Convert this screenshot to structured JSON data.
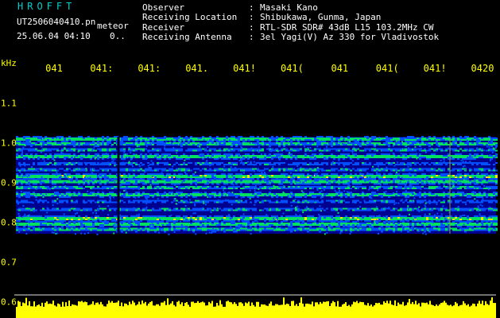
{
  "app": {
    "name": "HROFFT",
    "filename": "UT2506040410.pn",
    "mode": "meteor",
    "datetime": "25.06.04 04:10",
    "counter": "0.."
  },
  "station": [
    {
      "label": "Observer",
      "value": "Masaki Kano"
    },
    {
      "label": "Receiving Location",
      "value": "Shibukawa, Gunma, Japan"
    },
    {
      "label": "Receiver",
      "value": "RTL-SDR SDR# 43dB L15 103.2MHz CW"
    },
    {
      "label": "Receiving Antenna",
      "value": "3el Yagi(V) Az 330 for Vladivostok"
    }
  ],
  "axis": {
    "unit": "kHz",
    "time_ticks": [
      "041",
      "041:",
      "041:",
      "041.",
      "041!",
      "041(",
      "041",
      "041(",
      "041!",
      "0420"
    ],
    "freq_ticks": [
      {
        "label": "1.1",
        "khz": 1.1
      },
      {
        "label": "1.0",
        "khz": 1.0
      },
      {
        "label": "0.9",
        "khz": 0.9
      },
      {
        "label": "0.8",
        "khz": 0.8
      },
      {
        "label": "0.7",
        "khz": 0.7
      },
      {
        "label": "0.6",
        "khz": 0.6
      }
    ]
  },
  "colors": {
    "background": "#000000",
    "app_name": "#00d0d0",
    "header_text": "#ffffff",
    "time_ticks": "#ffff00",
    "freq_ticks": "#ffff00",
    "noise_low": "#000090",
    "noise_mid": "#0050ff",
    "signal_green": "#00e060",
    "signal_yellow": "#ffe000",
    "signal_red": "#ff3000",
    "level_bar": "#ffff00",
    "baseline": "#e0e0e0"
  }
}
